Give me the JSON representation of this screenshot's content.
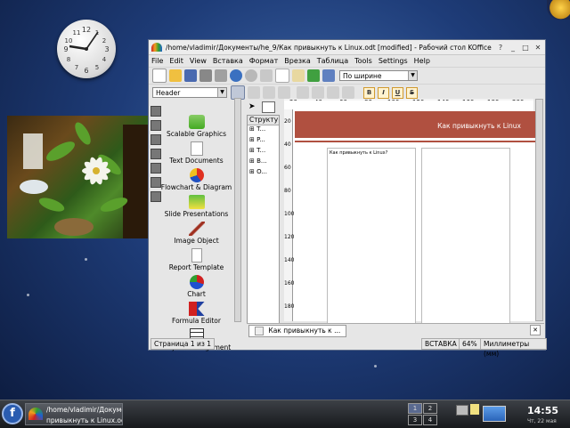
{
  "clock": {
    "numbers": [
      "12",
      "3",
      "6",
      "9",
      "11",
      "1",
      "2",
      "4",
      "5",
      "7",
      "8",
      "10"
    ]
  },
  "window": {
    "title": "/home/vladimir/Документы/he_9/Как привыкнуть к Linux.odt [modified] - Рабочий стол KOffice",
    "menu": [
      "File",
      "Edit",
      "View",
      "Вставка",
      "Формат",
      "Врезка",
      "Таблица",
      "Tools",
      "Settings",
      "Help"
    ]
  },
  "toolbar": {
    "zoom_combo": "По ширине",
    "style_combo": "Header",
    "format_buttons": [
      "B",
      "I",
      "U",
      "S"
    ]
  },
  "doc_types": [
    {
      "label": "Scalable Graphics",
      "icon": "scalable-graphics-icon"
    },
    {
      "label": "Text Documents",
      "icon": "text-documents-icon"
    },
    {
      "label": "Flowchart & Diagram",
      "icon": "flowchart-icon"
    },
    {
      "label": "Slide Presentations",
      "icon": "slide-presentations-icon"
    },
    {
      "label": "Image Object",
      "icon": "image-object-icon"
    },
    {
      "label": "Report Template",
      "icon": "report-template-icon"
    },
    {
      "label": "Chart",
      "icon": "chart-icon"
    },
    {
      "label": "Formula Editor",
      "icon": "formula-editor-icon"
    },
    {
      "label": "Project Management",
      "icon": "project-management-icon"
    }
  ],
  "structure": {
    "header": "Структу",
    "rows": [
      "⊞ T...",
      "⊞ P...",
      "⊞ T...",
      "⊞ B...",
      "⊞ O..."
    ]
  },
  "ruler": {
    "h_ticks": [
      "20",
      "40",
      "60",
      "80",
      "100",
      "120",
      "140",
      "160",
      "180",
      "200"
    ],
    "v_ticks": [
      "20",
      "40",
      "60",
      "80",
      "100",
      "120",
      "140",
      "160",
      "180"
    ]
  },
  "document": {
    "banner_text": "Как привыкнуть к Linux",
    "heading": "Как привыкнуть к Linux?"
  },
  "tab": {
    "label": "Как привыкнуть к ..."
  },
  "status": {
    "page": "Страница 1 из 1",
    "mode": "ВСТАВКА",
    "zoom": "64%",
    "units": "Миллиметры (мм)"
  },
  "taskbar": {
    "task_line1": "/home/vladimir/Докумен",
    "task_line2": "привыкнуть к Linux.odt",
    "pager": [
      "1",
      "2",
      "3",
      "4"
    ],
    "time": "14:55",
    "date": "Чт, 22 мая"
  }
}
